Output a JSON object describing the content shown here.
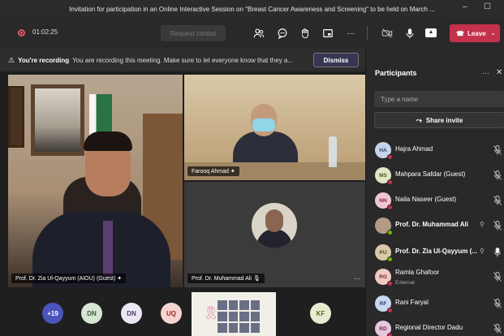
{
  "window": {
    "title": "Invitation for participation in an Online Interactive Session on \"Breast Cancer Awareness and Screening\" to be held on March ...",
    "minimize": "–",
    "maximize": "☐"
  },
  "controls": {
    "timer": "01:02:25",
    "request_control": "Request control",
    "more": "···",
    "leave": "Leave"
  },
  "banner": {
    "strong": "You're recording",
    "message": "You are recording this meeting. Make sure to let everyone know that they a...",
    "dismiss": "Dismiss"
  },
  "stage": {
    "main": {
      "name": "Prof. Dr. Zia Ul-Qayyum (AIOU) (Guest)",
      "pin": "✦"
    },
    "top_right": {
      "name": "Farooq Ahmad",
      "pin": "✦"
    },
    "bottom_right": {
      "name": "Prof. Dr. Muhammad Ali",
      "more": "···"
    }
  },
  "bottom_row": {
    "overflow": "+19",
    "tiles": [
      {
        "initials": "DN",
        "bg": "#d8e6d4",
        "fg": "#3b5a38"
      },
      {
        "initials": "DN",
        "bg": "#ece7f5",
        "fg": "#4b3d6a"
      },
      {
        "initials": "UQ",
        "bg": "#f7d4cf",
        "fg": "#9b2b24"
      },
      {
        "initials": "KF",
        "bg": "#e7ecd0",
        "fg": "#5b6a1f"
      }
    ]
  },
  "panel": {
    "title": "Participants",
    "more": "···",
    "close": "✕",
    "search_placeholder": "Type a name",
    "share_invite": "Share invite",
    "participants": [
      {
        "initials": "HA",
        "name": "Hajra Ahmad",
        "sub": "",
        "bg": "#c7d3ea",
        "fg": "#2d3f6a",
        "dot": "#c4314b",
        "bold": false
      },
      {
        "initials": "MS",
        "name": "Mahpara Safdar (Guest)",
        "sub": "",
        "bg": "#e0e6c6",
        "fg": "#4a5620",
        "dot": "#c4314b",
        "bold": false
      },
      {
        "initials": "NN",
        "name": "Naila Naseer (Guest)",
        "sub": "",
        "bg": "#f0c6d2",
        "fg": "#7a2a44",
        "dot": "#c4314b",
        "bold": false
      },
      {
        "initials": "",
        "name": "Prof. Dr. Muhammad Ali",
        "sub": "",
        "bg": "#b59a84",
        "fg": "#fff",
        "dot": "#6bb700",
        "bold": true
      },
      {
        "initials": "PU",
        "name": "Prof. Dr. Zia Ul-Qayyum (...",
        "sub": "",
        "bg": "#d8c9a8",
        "fg": "#5a4a20",
        "dot": "#6bb700",
        "bold": true
      },
      {
        "initials": "RG",
        "name": "Ramla Ghafoor",
        "sub": "External",
        "bg": "#f0c8c4",
        "fg": "#7a2a24",
        "dot": "#c4314b",
        "bold": false
      },
      {
        "initials": "RF",
        "name": "Rani Faryal",
        "sub": "",
        "bg": "#c8d6ee",
        "fg": "#2d3f6a",
        "dot": "#c4314b",
        "bold": false
      },
      {
        "initials": "RD",
        "name": "Regional Director Dadu",
        "sub": "",
        "bg": "#e6c6dc",
        "fg": "#6a2a55",
        "dot": "#c4314b",
        "bold": false
      }
    ]
  }
}
